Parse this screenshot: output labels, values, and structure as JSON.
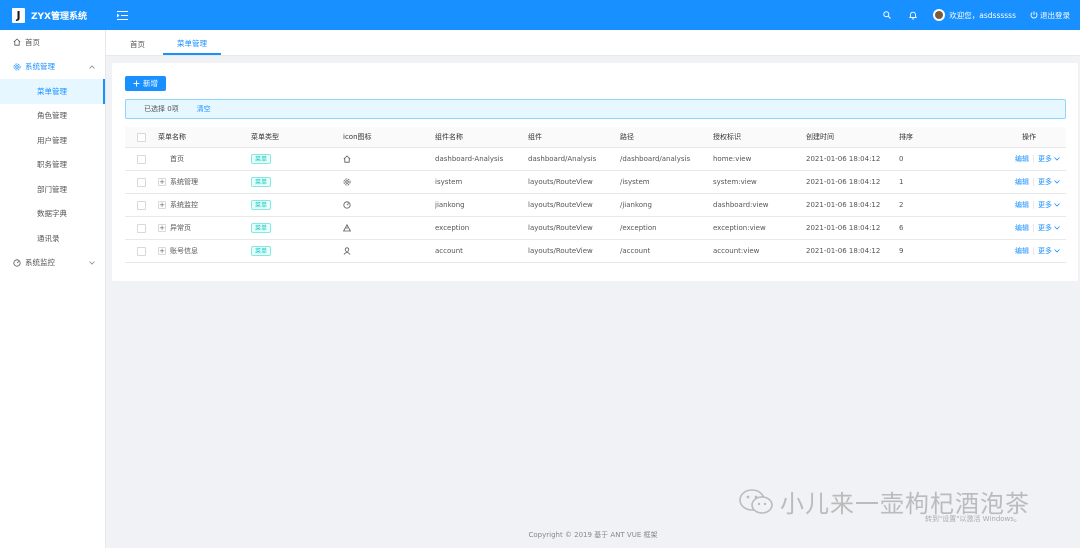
{
  "header": {
    "logo_letter": "J",
    "app_title": "ZYX管理系统",
    "menu_toggle_icon": "menu-fold-icon",
    "search_icon": "search-icon",
    "bell_icon": "bell-icon",
    "user_greeting": "欢迎您，asdssssss",
    "logout_label": "退出登录",
    "brand_color": "#1890ff"
  },
  "sidebar": {
    "home": "首页",
    "system_group": "系统管理",
    "sub_items": [
      "菜单管理",
      "角色管理",
      "用户管理",
      "职务管理",
      "部门管理",
      "数据字典",
      "通讯录"
    ],
    "monitor_group": "系统监控"
  },
  "tabs": [
    "首页",
    "菜单管理"
  ],
  "toolbar": {
    "add_label": "新增"
  },
  "alert": {
    "selected_text": "已选择 0项",
    "clear_label": "清空"
  },
  "table": {
    "columns": [
      "菜单名称",
      "菜单类型",
      "icon图标",
      "组件名称",
      "组件",
      "路径",
      "授权标识",
      "创建时间",
      "排序",
      "操作"
    ],
    "rows": [
      {
        "name": "首页",
        "expandable": false,
        "type": "菜单",
        "icon": "home-icon",
        "component_name": "dashboard-Analysis",
        "component": "dashboard/Analysis",
        "path": "/dashboard/analysis",
        "permission": "home:view",
        "created": "2021-01-06 18:04:12",
        "sort": "0"
      },
      {
        "name": "系统管理",
        "expandable": true,
        "type": "菜单",
        "icon": "setting-icon",
        "component_name": "isystem",
        "component": "layouts/RouteView",
        "path": "/isystem",
        "permission": "system:view",
        "created": "2021-01-06 18:04:12",
        "sort": "1"
      },
      {
        "name": "系统监控",
        "expandable": true,
        "type": "菜单",
        "icon": "dashboard-icon",
        "component_name": "jiankong",
        "component": "layouts/RouteView",
        "path": "/jiankong",
        "permission": "dashboard:view",
        "created": "2021-01-06 18:04:12",
        "sort": "2"
      },
      {
        "name": "异常页",
        "expandable": true,
        "type": "菜单",
        "icon": "warning-icon",
        "component_name": "exception",
        "component": "layouts/RouteView",
        "path": "/exception",
        "permission": "exception:view",
        "created": "2021-01-06 18:04:12",
        "sort": "6"
      },
      {
        "name": "账号信息",
        "expandable": true,
        "type": "菜单",
        "icon": "user-icon",
        "component_name": "account",
        "component": "layouts/RouteView",
        "path": "/account",
        "permission": "account:view",
        "created": "2021-01-06 18:04:12",
        "sort": "9"
      }
    ],
    "edit_label": "编辑",
    "more_label": "更多"
  },
  "footer": {
    "copyright": "Copyright © 2019 基于 ANT VUE 框架"
  },
  "watermark": {
    "text": "小儿来一壶枸杞酒泡茶",
    "activation_hint": "转到\"设置\"以激活 Windows。"
  }
}
